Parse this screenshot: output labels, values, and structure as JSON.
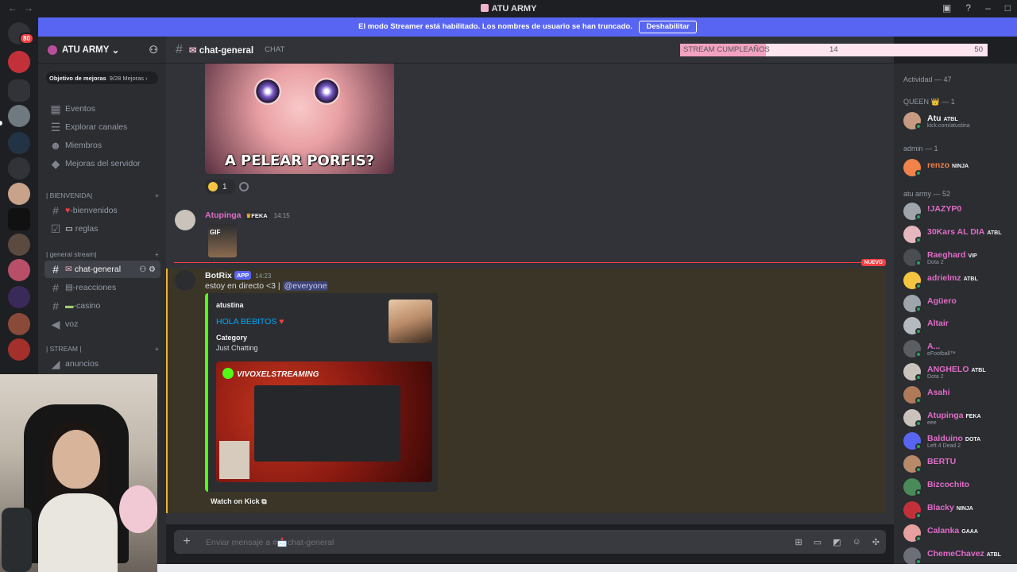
{
  "window": {
    "title": "ATU ARMY"
  },
  "banner": {
    "text": "El modo Streamer está habilitado. Los nombres de usuario se han truncado.",
    "button": "Deshabilitar"
  },
  "rail": {
    "badge": "80"
  },
  "server": {
    "name": "ATU ARMY",
    "boost_label": "Objetivo de mejoras",
    "boost_count": "9/28 Mejoras",
    "nav": [
      "Eventos",
      "Explorar canales",
      "Miembros",
      "Mejoras del servidor"
    ],
    "categories": [
      "| BIENVENIDA|",
      "| general stream|",
      "| STREAM |"
    ],
    "channels": [
      "-bienvenidos",
      "reglas",
      "chat-general",
      "-reacciones",
      "-casino",
      "voz",
      "anuncios"
    ]
  },
  "chatbar": {
    "channel": "chat-general",
    "tag": "CHAT"
  },
  "progress": {
    "label": "STREAM CUMPLEAÑOS",
    "current": "14",
    "goal": "50",
    "fraction": 0.28
  },
  "messages": {
    "meme_caption": "A PELEAR PORFIS?",
    "reaction_count": "1",
    "m1": {
      "author": "Atupinga",
      "tag": "FEKA",
      "time": "14:15",
      "gif": "GIF"
    },
    "new_label": "NUEVO",
    "m2": {
      "author": "BotRix",
      "app": "APP",
      "time": "14:23",
      "text": "estoy en directo <3 |",
      "mention": "@everyone",
      "embed": {
        "author": "atustina",
        "title": "HOLA BEBITOS",
        "field_name": "Category",
        "field_value": "Just Chatting",
        "preview_label": "VIVOXELSTREAMING",
        "link": "Watch on Kick"
      }
    }
  },
  "composer": {
    "placeholder": "Enviar mensaje a #📩chat-general"
  },
  "members": {
    "activity": "Actividad — 47",
    "queen_cat": "QUEEN 👑 — 1",
    "admin_cat": "admin — 1",
    "army_cat": "atu army — 52",
    "list": [
      {
        "name": "Atu",
        "tag": "ATBL",
        "sub": "kick.com/atustina",
        "color": "#f2f3f5"
      },
      {
        "name": "renzo",
        "tag": "NINJA",
        "sub": "",
        "color": "#f0824a"
      },
      {
        "name": "!JAZYP0",
        "tag": "",
        "sub": "",
        "color": "#e06cc8"
      },
      {
        "name": "30Kars AL DIA",
        "tag": "ATBL",
        "sub": "",
        "color": "#e06cc8"
      },
      {
        "name": "Raeghard",
        "tag": "VIP",
        "sub": "Dota 2",
        "color": "#e06cc8"
      },
      {
        "name": "adrielmz",
        "tag": "ATBL",
        "sub": "",
        "color": "#e06cc8"
      },
      {
        "name": "Agüero",
        "tag": "",
        "sub": "",
        "color": "#e06cc8"
      },
      {
        "name": "Altair",
        "tag": "",
        "sub": "",
        "color": "#e06cc8"
      },
      {
        "name": "A...",
        "tag": "",
        "sub": "eFootball™",
        "color": "#e06cc8"
      },
      {
        "name": "ANGHELO",
        "tag": "ATBL",
        "sub": "Dota 2",
        "color": "#e06cc8"
      },
      {
        "name": "Asahi",
        "tag": "",
        "sub": "",
        "color": "#e06cc8"
      },
      {
        "name": "Atupinga",
        "tag": "FEKA",
        "sub": "eee",
        "color": "#e06cc8"
      },
      {
        "name": "Balduino",
        "tag": "DOTA",
        "sub": "Left 4 Dead 2",
        "color": "#e06cc8"
      },
      {
        "name": "BERTU",
        "tag": "",
        "sub": "",
        "color": "#e06cc8"
      },
      {
        "name": "Bizcochito",
        "tag": "",
        "sub": "",
        "color": "#e06cc8"
      },
      {
        "name": "Blacky",
        "tag": "NINJA",
        "sub": "",
        "color": "#e06cc8"
      },
      {
        "name": "Calanka",
        "tag": "GAAA",
        "sub": "",
        "color": "#e06cc8"
      },
      {
        "name": "ChemeChavez",
        "tag": "ATBL",
        "sub": "",
        "color": "#e06cc8"
      }
    ]
  },
  "colors": {
    "blurple": "#5865f2",
    "kick_green": "#53fc18",
    "role_pink": "#e06cc8",
    "mention_bg": "#3c4270"
  }
}
